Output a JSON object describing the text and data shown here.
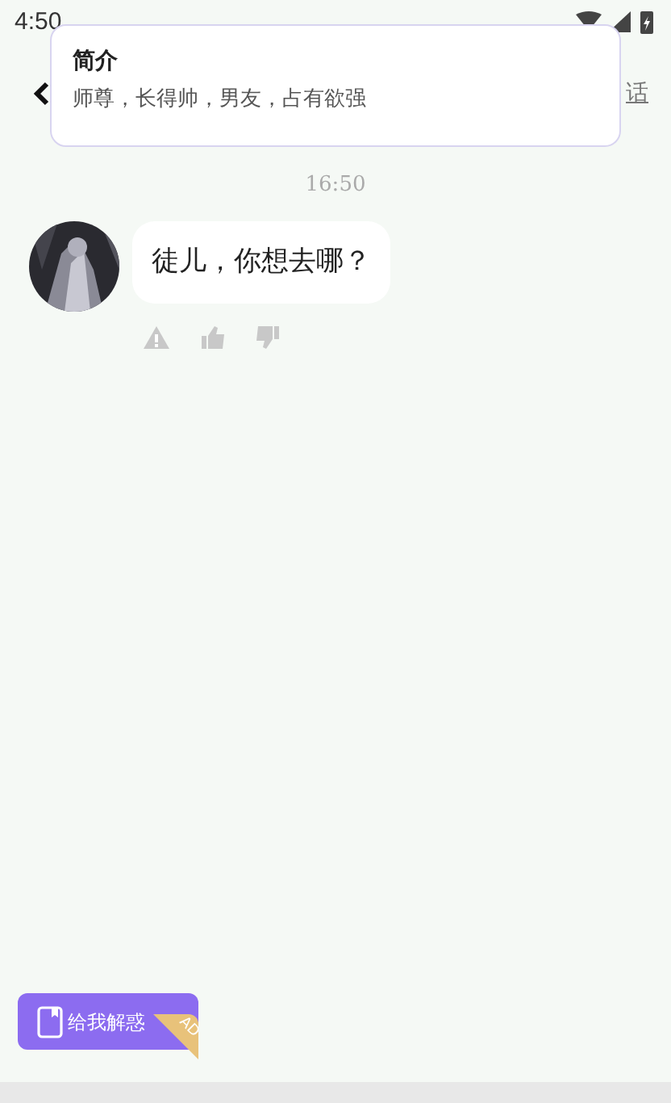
{
  "status_bar": {
    "time": "4:50"
  },
  "header": {
    "action": "话"
  },
  "intro_popup": {
    "title": "简介",
    "text": "师尊，长得帅，男友，占有欲强"
  },
  "chat": {
    "timestamp": "16:50",
    "messages": [
      {
        "text": "徒儿，你想去哪？"
      }
    ]
  },
  "ad_button": {
    "label": "给我解惑",
    "badge": "AD"
  }
}
